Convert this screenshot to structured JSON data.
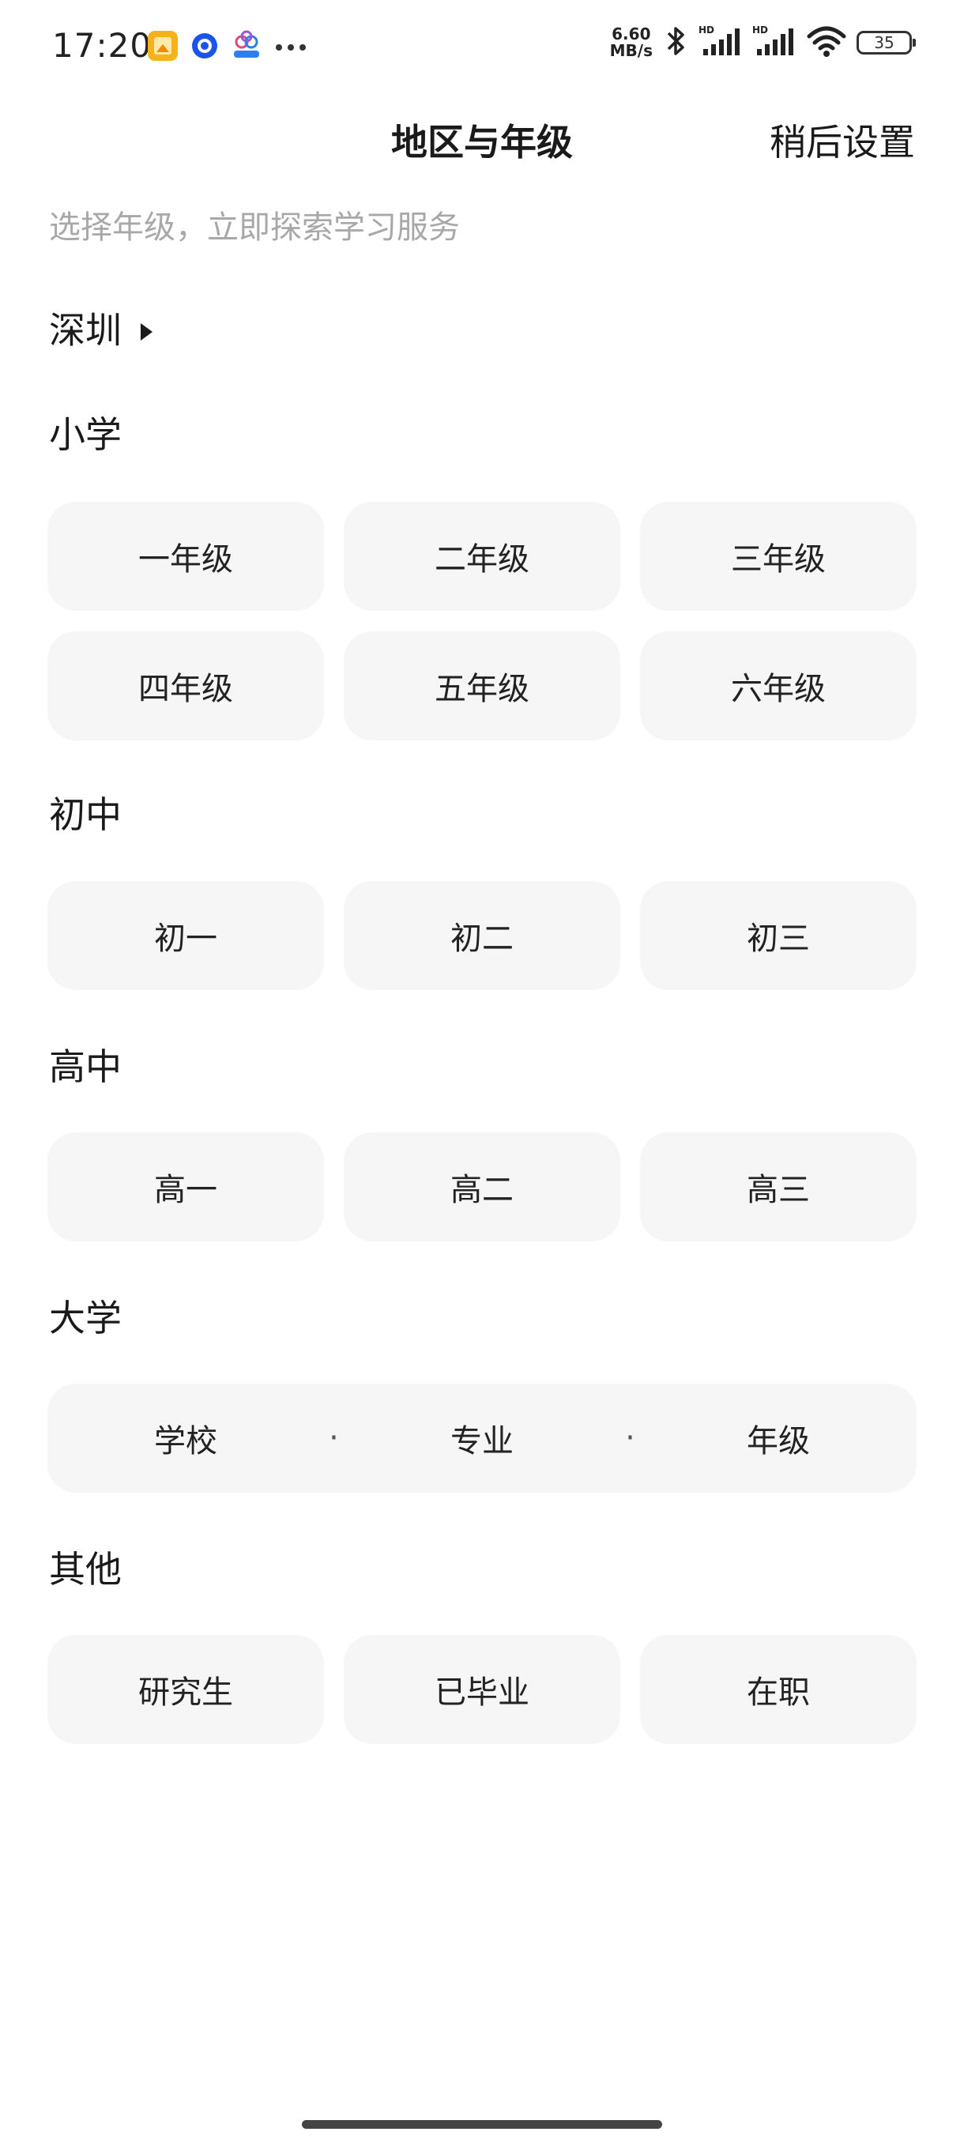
{
  "status_bar": {
    "time": "17:20",
    "net_speed_value": "6.60",
    "net_speed_unit": "MB/s",
    "battery": "35",
    "colors": {
      "gallery_icon": "#f5b21b",
      "browser_icon": "#1a55e8",
      "app_icon": "#2b7ff0"
    },
    "icons": [
      "gallery-icon",
      "browser-icon",
      "app-icon",
      "more-dots-icon",
      "bluetooth-icon",
      "signal-hd-icon",
      "signal-hd-icon",
      "wifi-icon",
      "battery-icon"
    ]
  },
  "header": {
    "title": "地区与年级",
    "later_label": "稍后设置"
  },
  "subtitle": "选择年级，立即探索学习服务",
  "region": {
    "city": "深圳",
    "icon": "triangle-right-icon"
  },
  "sections": {
    "primary": {
      "title": "小学",
      "grades": [
        "一年级",
        "二年级",
        "三年级",
        "四年级",
        "五年级",
        "六年级"
      ]
    },
    "junior": {
      "title": "初中",
      "grades": [
        "初一",
        "初二",
        "初三"
      ]
    },
    "senior": {
      "title": "高中",
      "grades": [
        "高一",
        "高二",
        "高三"
      ]
    },
    "university": {
      "title": "大学",
      "parts": [
        "学校",
        "专业",
        "年级"
      ],
      "separator": "·"
    },
    "other": {
      "title": "其他",
      "options": [
        "研究生",
        "已毕业",
        "在职"
      ]
    }
  },
  "colors": {
    "chip_background": "#f6f6f6",
    "text": "#222222",
    "subtitle_text": "#a8a8a8"
  }
}
